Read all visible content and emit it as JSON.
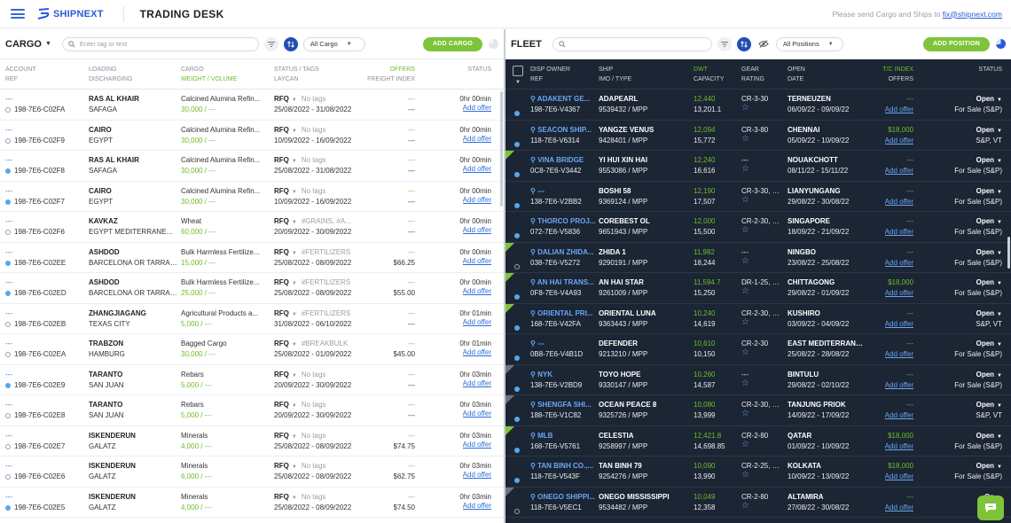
{
  "app": {
    "logo": "SHIPNEXT",
    "title": "TRADING DESK",
    "notice_prefix": "Please send Cargo and Ships to ",
    "notice_email": "fix@shipnext.com"
  },
  "cargo": {
    "title": "CARGO",
    "search_placeholder": "Enter tag or text",
    "filter": "All Cargo",
    "add_label": "ADD CARGO",
    "headers": {
      "account": "ACCOUNT",
      "ref": "REF",
      "loading": "LOADING",
      "discharging": "DISCHARGING",
      "cargo": "CARGO",
      "weight": "WEIGHT / VOLUME",
      "status": "STATUS / TAGS",
      "laycan": "LAYCAN",
      "offers": "OFFERS",
      "freight": "FREIGHT INDEX",
      "status2": "STATUS"
    },
    "rows": [
      {
        "account": "---",
        "ref": "198-7E6-C02FA",
        "dot": "open",
        "loading": "RAS AL KHAIR",
        "discharging": "SAFAGA",
        "cargo": "Calcined Alumina Refin...",
        "weight": "30,000 / ---",
        "status": "RFQ",
        "tags": "No tags",
        "laycan": "25/08/2022 - 31/08/2022",
        "offers": "---",
        "freight": "---",
        "time": "0hr 00min",
        "add": "Add offer"
      },
      {
        "account": "---",
        "ref": "198-7E6-C02F9",
        "dot": "open",
        "loading": "CAIRO",
        "discharging": "EGYPT",
        "cargo": "Calcined Alumina Refin...",
        "weight": "30,000 / ---",
        "status": "RFQ",
        "tags": "No tags",
        "laycan": "10/09/2022 - 16/09/2022",
        "offers": "---",
        "freight": "---",
        "time": "0hr 00min",
        "add": "Add offer"
      },
      {
        "account": "---",
        "ref": "198-7E6-C02F8",
        "dot": "fill",
        "loading": "RAS AL KHAIR",
        "discharging": "SAFAGA",
        "cargo": "Calcined Alumina Refin...",
        "weight": "30,000 / ---",
        "status": "RFQ",
        "tags": "No tags",
        "laycan": "25/08/2022 - 31/08/2022",
        "offers": "---",
        "freight": "---",
        "time": "0hr 00min",
        "add": "Add offer"
      },
      {
        "account": "---",
        "ref": "198-7E6-C02F7",
        "dot": "fill",
        "loading": "CAIRO",
        "discharging": "EGYPT",
        "cargo": "Calcined Alumina Refin...",
        "weight": "30,000 / ---",
        "status": "RFQ",
        "tags": "No tags",
        "laycan": "10/09/2022 - 16/09/2022",
        "offers": "---",
        "freight": "---",
        "time": "0hr 00min",
        "add": "Add offer"
      },
      {
        "account": "---",
        "ref": "198-7E6-C02F6",
        "dot": "open",
        "loading": "KAVKAZ",
        "discharging": "EGYPT MEDITERRANEAN ...",
        "cargo": "Wheat",
        "weight": "60,000 / ---",
        "status": "RFQ",
        "tags": "#GRAINS, #A...",
        "laycan": "20/09/2022 - 30/09/2022",
        "offers": "---",
        "freight": "---",
        "time": "0hr 00min",
        "add": "Add offer"
      },
      {
        "account": "---",
        "ref": "198-7E6-C02EE",
        "dot": "fill",
        "loading": "ASHDOD",
        "discharging": "BARCELONA OR TARRAGO...",
        "cargo": "Bulk Harmless Fertilize...",
        "weight": "15,000 / ---",
        "status": "RFQ",
        "tags": "#FERTILIZERS",
        "laycan": "25/08/2022 - 08/09/2022",
        "offers": "---",
        "freight": "$66.25",
        "time": "0hr 00min",
        "add": "Add offer"
      },
      {
        "account": "---",
        "ref": "198-7E6-C02ED",
        "dot": "fill",
        "loading": "ASHDOD",
        "discharging": "BARCELONA OR TARRAGO...",
        "cargo": "Bulk Harmless Fertilize...",
        "weight": "25,000 / ---",
        "status": "RFQ",
        "tags": "#FERTILIZERS",
        "laycan": "25/08/2022 - 08/09/2022",
        "offers": "---",
        "freight": "$55.00",
        "time": "0hr 00min",
        "add": "Add offer"
      },
      {
        "account": "---",
        "ref": "198-7E6-C02EB",
        "dot": "open",
        "loading": "ZHANGJIAGANG",
        "discharging": "TEXAS CITY",
        "cargo": "Agricultural Products a...",
        "weight": "5,000 / ---",
        "status": "RFQ",
        "tags": "#FERTILIZERS",
        "laycan": "31/08/2022 - 06/10/2022",
        "offers": "---",
        "freight": "---",
        "time": "0hr 01min",
        "add": "Add offer"
      },
      {
        "account": "---",
        "ref": "198-7E6-C02EA",
        "dot": "open",
        "loading": "TRABZON",
        "discharging": "HAMBURG",
        "cargo": "Bagged Cargo",
        "weight": "30,000 / ---",
        "status": "RFQ",
        "tags": "#BREAKBULK",
        "laycan": "25/08/2022 - 01/09/2022",
        "offers": "---",
        "freight": "$45.00",
        "time": "0hr 01min",
        "add": "Add offer"
      },
      {
        "account": "---",
        "ref": "198-7E6-C02E9",
        "dot": "fill",
        "loading": "TARANTO",
        "discharging": "SAN JUAN",
        "cargo": "Rebars",
        "weight": "5,000 / ---",
        "status": "RFQ",
        "tags": "No tags",
        "laycan": "20/09/2022 - 30/09/2022",
        "offers": "---",
        "freight": "---",
        "time": "0hr 03min",
        "add": "Add offer"
      },
      {
        "account": "---",
        "ref": "198-7E6-C02E8",
        "dot": "open",
        "loading": "TARANTO",
        "discharging": "SAN JUAN",
        "cargo": "Rebars",
        "weight": "5,000 / ---",
        "status": "RFQ",
        "tags": "No tags",
        "laycan": "20/09/2022 - 30/09/2022",
        "offers": "---",
        "freight": "---",
        "time": "0hr 03min",
        "add": "Add offer"
      },
      {
        "account": "---",
        "ref": "198-7E6-C02E7",
        "dot": "open",
        "loading": "ISKENDERUN",
        "discharging": "GALATZ",
        "cargo": "Minerals",
        "weight": "4,000 / ---",
        "status": "RFQ",
        "tags": "No tags",
        "laycan": "25/08/2022 - 08/09/2022",
        "offers": "---",
        "freight": "$74.75",
        "time": "0hr 03min",
        "add": "Add offer"
      },
      {
        "account": "---",
        "ref": "198-7E6-C02E6",
        "dot": "open",
        "loading": "ISKENDERUN",
        "discharging": "GALATZ",
        "cargo": "Minerals",
        "weight": "6,000 / ---",
        "status": "RFQ",
        "tags": "No tags",
        "laycan": "25/08/2022 - 08/09/2022",
        "offers": "---",
        "freight": "$62.75",
        "time": "0hr 03min",
        "add": "Add offer"
      },
      {
        "account": "---",
        "ref": "198-7E6-C02E5",
        "dot": "fill",
        "loading": "ISKENDERUN",
        "discharging": "GALATZ",
        "cargo": "Minerals",
        "weight": "4,000 / ---",
        "status": "RFQ",
        "tags": "No tags",
        "laycan": "25/08/2022 - 08/09/2022",
        "offers": "---",
        "freight": "$74.50",
        "time": "0hr 03min",
        "add": "Add offer"
      }
    ]
  },
  "fleet": {
    "title": "FLEET",
    "filter": "All Positions",
    "add_label": "ADD POSITION",
    "headers": {
      "owner": "DISP OWNER",
      "ref": "REF",
      "ship": "SHIP",
      "imo": "IMO / TYPE",
      "dwt": "DWT",
      "capacity": "CAPACITY",
      "gear": "GEAR",
      "rating": "RATING",
      "open": "OPEN",
      "date": "DATE",
      "tc": "T/C INDEX",
      "offers": "OFFERS",
      "status": "STATUS"
    },
    "rows": [
      {
        "tri": "none",
        "owner": "ADAKENT GE...",
        "ref": "198-7E6-V4367",
        "dot": "fill",
        "ship": "ADAPEARL",
        "imo": "9539432 / MPP",
        "dwt": "12,440",
        "cap": "13,201.1",
        "gear": "CR-3-30",
        "open": "TERNEUZEN",
        "date": "06/09/22 - 09/09/22",
        "tc": "---",
        "add": "Add offer",
        "st1": "Open",
        "st2": "For Sale (S&P)"
      },
      {
        "tri": "none",
        "owner": "SEACON SHIP...",
        "ref": "118-7E6-V6314",
        "dot": "fill",
        "ship": "YANGZE VENUS",
        "imo": "9428401 / MPP",
        "dwt": "12,094",
        "cap": "15,772",
        "gear": "CR-3-80",
        "open": "CHENNAI",
        "date": "05/09/22 - 10/09/22",
        "tc": "$18,000",
        "add": "Add offer",
        "st1": "Open",
        "st2": "S&P, VT"
      },
      {
        "tri": "green",
        "owner": "VINA BRIDGE",
        "ref": "0C8-7E6-V3442",
        "dot": "fill",
        "ship": "YI HUI XIN HAI",
        "imo": "9553086 / MPP",
        "dwt": "12,240",
        "cap": "16,616",
        "gear": "---",
        "open": "NOUAKCHOTT",
        "date": "08/11/22 - 15/11/22",
        "tc": "---",
        "add": "Add offer",
        "st1": "Open",
        "st2": "For Sale (S&P)"
      },
      {
        "tri": "none",
        "owner": "---",
        "ref": "138-7E6-V2BB2",
        "dot": "fill",
        "ship": "BOSHI 58",
        "imo": "9369124 / MPP",
        "dwt": "12,190",
        "cap": "17,507",
        "gear": "CR-3-30, DR...",
        "open": "LIANYUNGANG",
        "date": "29/08/22 - 30/08/22",
        "tc": "---",
        "add": "Add offer",
        "st1": "Open",
        "st2": "For Sale (S&P)"
      },
      {
        "tri": "none",
        "owner": "THORCO PROJ...",
        "ref": "072-7E6-V5836",
        "dot": "fill",
        "ship": "COREBEST OL",
        "imo": "9651943 / MPP",
        "dwt": "12,000",
        "cap": "15,500",
        "gear": "CR-2-30, DR...",
        "open": "SINGAPORE",
        "date": "18/09/22 - 21/09/22",
        "tc": "---",
        "add": "Add offer",
        "st1": "Open",
        "st2": "For Sale (S&P)"
      },
      {
        "tri": "green",
        "owner": "DALIAN ZHIDA...",
        "ref": "038-7E6-V5272",
        "dot": "open",
        "ship": "ZHIDA 1",
        "imo": "9290191 / MPP",
        "dwt": "11,982",
        "cap": "18,244",
        "gear": "---",
        "open": "NINGBO",
        "date": "23/08/22 - 25/08/22",
        "tc": "---",
        "add": "Add offer",
        "st1": "Open",
        "st2": "For Sale (S&P)"
      },
      {
        "tri": "green",
        "owner": "AN HAI TRANS...",
        "ref": "0F8-7E6-V4A93",
        "dot": "fill",
        "ship": "AN HAI STAR",
        "imo": "9261009 / MPP",
        "dwt": "11,594.7",
        "cap": "15,250",
        "gear": "DR-1-25, CR...",
        "open": "CHITTAGONG",
        "date": "29/08/22 - 01/09/22",
        "tc": "$18,000",
        "add": "Add offer",
        "st1": "Open",
        "st2": "For Sale (S&P)"
      },
      {
        "tri": "green",
        "owner": "ORIENTAL PRI...",
        "ref": "168-7E6-V42FA",
        "dot": "fill",
        "ship": "ORIENTAL LUNA",
        "imo": "9363443 / MPP",
        "dwt": "10,240",
        "cap": "14,619",
        "gear": "CR-2-30, DR...",
        "open": "KUSHIRO",
        "date": "03/09/22 - 04/09/22",
        "tc": "---",
        "add": "Add offer",
        "st1": "Open",
        "st2": "S&P, VT"
      },
      {
        "tri": "none",
        "owner": "---",
        "ref": "0B8-7E6-V4B1D",
        "dot": "fill",
        "ship": "DEFENDER",
        "imo": "9213210 / MPP",
        "dwt": "10,610",
        "cap": "10,150",
        "gear": "CR-2-30",
        "open": "EAST MEDITERRANEAN...",
        "date": "25/08/22 - 28/08/22",
        "tc": "---",
        "add": "Add offer",
        "st1": "Open",
        "st2": "For Sale (S&P)"
      },
      {
        "tri": "grey",
        "owner": "NYK",
        "ref": "138-7E6-V2BD9",
        "dot": "fill",
        "ship": "TOYO HOPE",
        "imo": "9330147 / MPP",
        "dwt": "10,260",
        "cap": "14,587",
        "gear": "---",
        "open": "BINTULU",
        "date": "29/08/22 - 02/10/22",
        "tc": "---",
        "add": "Add offer",
        "st1": "Open",
        "st2": "For Sale (S&P)"
      },
      {
        "tri": "grey",
        "owner": "SHENGFA SHI...",
        "ref": "188-7E6-V1C82",
        "dot": "fill",
        "ship": "OCEAN PEACE 8",
        "imo": "9325726 / MPP",
        "dwt": "10,080",
        "cap": "13,999",
        "gear": "CR-2-30, CR...",
        "open": "TANJUNG PRIOK",
        "date": "14/09/22 - 17/09/22",
        "tc": "---",
        "add": "Add offer",
        "st1": "Open",
        "st2": "S&P, VT"
      },
      {
        "tri": "green",
        "owner": "MLB",
        "ref": "168-7E6-V5761",
        "dot": "fill",
        "ship": "CELESTIA",
        "imo": "9258997 / MPP",
        "dwt": "12,421.8",
        "cap": "14,698.85",
        "gear": "CR-2-80",
        "open": "QATAR",
        "date": "01/09/22 - 10/09/22",
        "tc": "$18,000",
        "add": "Add offer",
        "st1": "Open",
        "st2": "For Sale (S&P)"
      },
      {
        "tri": "none",
        "owner": "TAN BINH CO.,...",
        "ref": "118-7E6-V543F",
        "dot": "fill",
        "ship": "TAN BINH 79",
        "imo": "9254276 / MPP",
        "dwt": "10,090",
        "cap": "13,990",
        "gear": "CR-2-25, DR...",
        "open": "KOLKATA",
        "date": "10/09/22 - 13/09/22",
        "tc": "$18,000",
        "add": "Add offer",
        "st1": "Open",
        "st2": "For Sale (S&P)"
      },
      {
        "tri": "grey",
        "owner": "ONEGO SHIPPI...",
        "ref": "118-7E6-V5EC1",
        "dot": "open",
        "ship": "ONEGO MISSISSIPPI",
        "imo": "9534482 / MPP",
        "dwt": "10,049",
        "cap": "12,358",
        "gear": "CR-2-80",
        "open": "ALTAMIRA",
        "date": "27/08/22 - 30/08/22",
        "tc": "---",
        "add": "Add offer",
        "st1": "Op",
        "st2": "For S"
      }
    ]
  }
}
